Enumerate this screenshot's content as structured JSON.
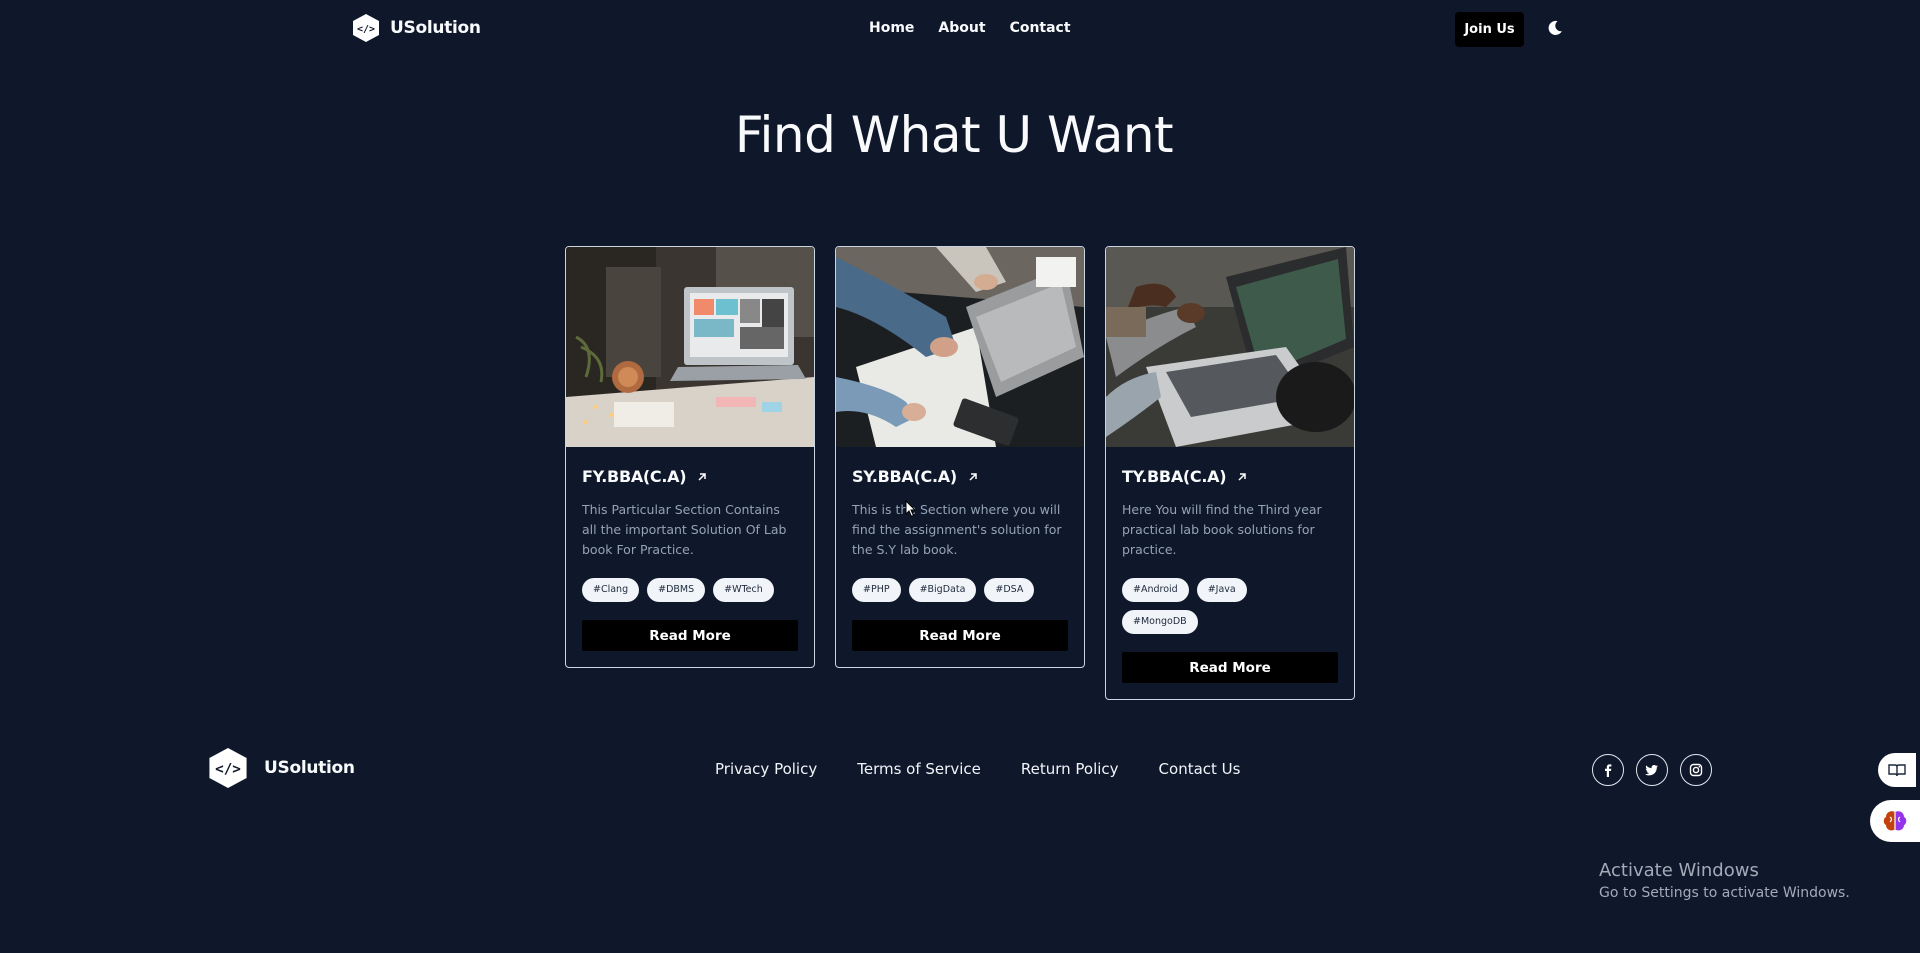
{
  "header": {
    "brand": "USolution",
    "nav": [
      "Home",
      "About",
      "Contact"
    ],
    "join_label": "Join Us",
    "theme_icon": "moon-icon"
  },
  "hero": {
    "title": "Find What U Want"
  },
  "cards": [
    {
      "title": "FY.BBA(C.A)",
      "description": "This Particular Section Contains all the important Solution Of Lab book For Practice.",
      "tags": [
        "#Clang",
        "#DBMS",
        "#WTech"
      ],
      "button": "Read More",
      "image": "laptop-desk-photo"
    },
    {
      "title": "SY.BBA(C.A)",
      "description": "This is the Section where you will find the assignment's solution for the S.Y lab book.",
      "tags": [
        "#PHP",
        "#BigData",
        "#DSA"
      ],
      "button": "Read More",
      "image": "people-writing-laptop-photo"
    },
    {
      "title": "TY.BBA(C.A)",
      "description": "Here You will find the Third year practical lab book solutions for practice.",
      "tags": [
        "#Android",
        "#Java",
        "#MongoDB"
      ],
      "button": "Read More",
      "image": "hands-laptop-photo"
    }
  ],
  "footer": {
    "brand": "USolution",
    "links": [
      "Privacy Policy",
      "Terms of Service",
      "Return Policy",
      "Contact Us"
    ],
    "social_icons": [
      "facebook-icon",
      "twitter-icon",
      "instagram-icon"
    ]
  },
  "watermark": {
    "title": "Activate Windows",
    "subtitle": "Go to Settings to activate Windows."
  },
  "colors": {
    "background": "#0f172a",
    "button": "#000000",
    "tag_bg": "#f1f5f9",
    "muted_text": "#94a3b8"
  }
}
